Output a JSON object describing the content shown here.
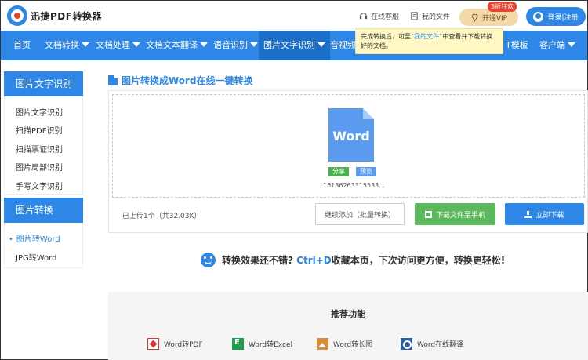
{
  "header": {
    "app_title": "迅捷PDF转换器",
    "online_service": "在线客服",
    "my_files": "我的文件",
    "vip_label": "开通VIP",
    "vip_badge": "3折狂欢",
    "login_label": "登录|注册"
  },
  "nav": {
    "items": [
      {
        "label": "首页"
      },
      {
        "label": "文档转换"
      },
      {
        "label": "文档处理"
      },
      {
        "label": "文档文本翻译"
      },
      {
        "label": "语音识别"
      },
      {
        "label": "图片文字识别"
      },
      {
        "label": "音视频"
      },
      {
        "label": "T模板"
      },
      {
        "label": "客户端"
      }
    ]
  },
  "tooltip": {
    "text_before": "完成转换后，可至",
    "highlight": "“我的文件”",
    "text_after": "中查看并下载转换好的文档。"
  },
  "sidebar": {
    "group1_title": "图片文字识别",
    "group1_items": [
      "图片文字识别",
      "扫描PDF识别",
      "扫描票证识别",
      "图片局部识别",
      "手写文字识别"
    ],
    "group2_title": "图片转换",
    "group2_items": [
      "图片转Word",
      "JPG转Word"
    ]
  },
  "main": {
    "title": "图片转换成Word在线一键转换",
    "doc_label": "Word",
    "share_tag": "分享",
    "preview_tag": "预览",
    "file_name": "16136263315533...",
    "upload_count": "已上传1个（共32.03K）",
    "continue_button": "继续添加（批量转换）",
    "mobile_button": "下载文件至手机",
    "download_button": "立即下载"
  },
  "promo": {
    "text_before": "转换效果还不错?",
    "highlight": "Ctrl+D",
    "text_after": "收藏本页，下次访问更方便，转换更轻松!"
  },
  "recommend": {
    "title": "推荐功能",
    "items": [
      "Word转PDF",
      "Word转Excel",
      "Word转长图",
      "Word在线翻译"
    ]
  },
  "colors": {
    "primary": "#2e86e6",
    "success": "#5cb85c",
    "vip": "#f4d9a8"
  }
}
